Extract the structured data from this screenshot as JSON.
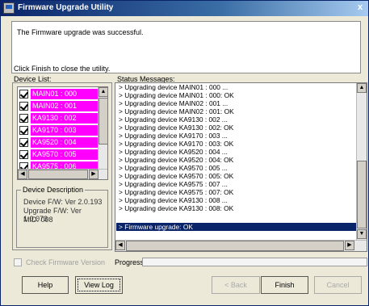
{
  "window": {
    "title": "Firmware Upgrade Utility",
    "close_label": "x"
  },
  "message": {
    "text": "The Firmware upgrade was successful.",
    "hint": "Click Finish to close the utility."
  },
  "device_list": {
    "label": "Device List:",
    "items": [
      {
        "name": "MAIN01 : 000",
        "checked": true
      },
      {
        "name": "MAIN02 : 001",
        "checked": true
      },
      {
        "name": "KA9130 : 002",
        "checked": true
      },
      {
        "name": "KA9170 : 003",
        "checked": true
      },
      {
        "name": "KA9520 : 004",
        "checked": true
      },
      {
        "name": "KA9570 : 005",
        "checked": true
      },
      {
        "name": "KA9575 : 006",
        "checked": true
      }
    ]
  },
  "device_description": {
    "legend": "Device Description",
    "lines": [
      "Device F/W: Ver 2.0.193",
      "Upgrade F/W: Ver 1.0.073",
      "MID: 008"
    ]
  },
  "status": {
    "label": "Status Messages:",
    "lines": [
      "> Upgrading device MAIN01 : 000 ...",
      "> Upgrading device MAIN01 : 000: OK",
      "> Upgrading device MAIN02 : 001 ...",
      "> Upgrading device MAIN02 : 001: OK",
      "> Upgrading device KA9130 : 002 ...",
      "> Upgrading device KA9130 : 002: OK",
      "> Upgrading device KA9170 : 003 ...",
      "> Upgrading device KA9170 : 003: OK",
      "> Upgrading device KA9520 : 004 ...",
      "> Upgrading device KA9520 : 004: OK",
      "> Upgrading device KA9570 : 005 ...",
      "> Upgrading device KA9570 : 005: OK",
      "> Upgrading device KA9575 : 007 ...",
      "> Upgrading device KA9575 : 007: OK",
      "> Upgrading device KA9130 : 008 ...",
      "> Upgrading device KA9130 : 008: OK"
    ],
    "selected_line": "> Firmware upgrade: OK"
  },
  "options": {
    "check_firmware_label": "Check Firmware Version",
    "progress_label": "Progress"
  },
  "buttons": {
    "help": "Help",
    "view_log": "View Log",
    "back": "< Back",
    "finish": "Finish",
    "cancel": "Cancel"
  },
  "colors": {
    "device_highlight": "#ff00ff",
    "selection": "#0a246a",
    "title_bar": "#0a246a"
  }
}
